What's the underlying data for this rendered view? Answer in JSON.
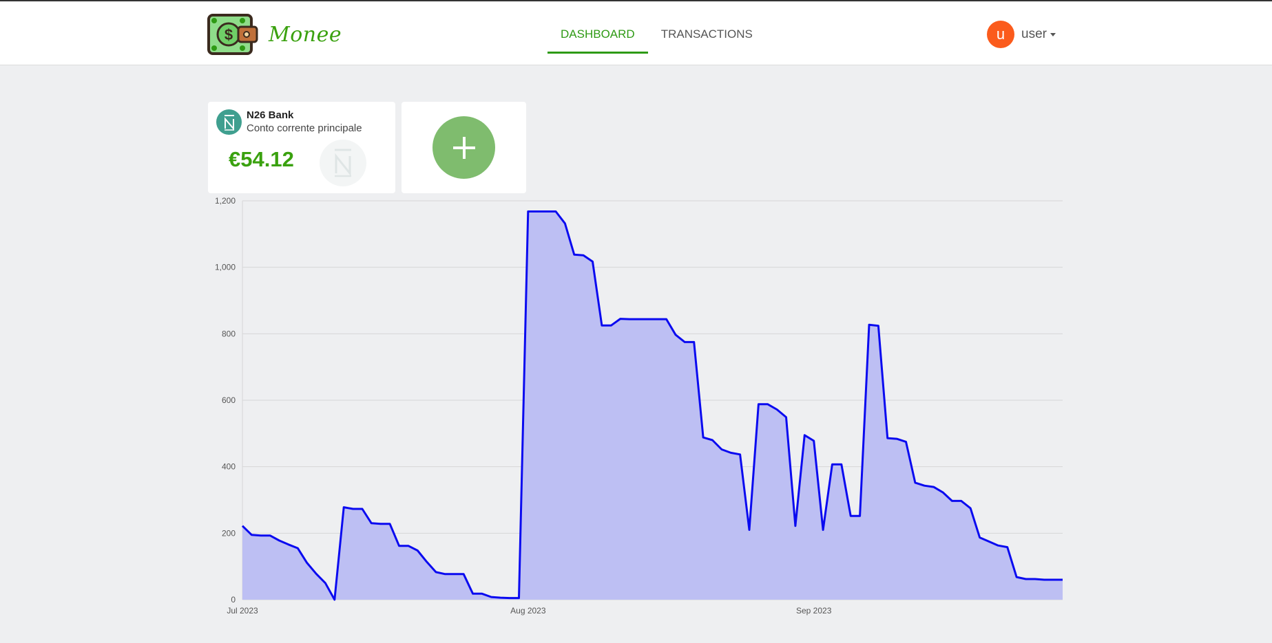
{
  "header": {
    "brand_name": "Monee",
    "logo_icon": "wallet-money-icon",
    "tabs": [
      {
        "label": "DASHBOARD",
        "active": true
      },
      {
        "label": "TRANSACTIONS",
        "active": false
      }
    ],
    "user": {
      "avatar_letter": "u",
      "name": "user"
    }
  },
  "accounts": [
    {
      "bank_name": "N26 Bank",
      "bank_icon": "n26-logo-icon",
      "description": "Conto corrente principale",
      "balance": "€54.12"
    }
  ],
  "add_account": {
    "icon": "plus-icon"
  },
  "colors": {
    "brand": "#3aa10f",
    "active_tab": "#2e9a14",
    "avatar": "#fb5b1c",
    "bank_badge": "#3f9f8f",
    "add_button": "#7fbc6e",
    "series_line": "#0a0af0",
    "series_fill": "#bdbff3"
  },
  "chart_data": {
    "type": "area",
    "x_ticks": [
      "Jul 2023",
      "Aug 2023",
      "Sep 2023"
    ],
    "y_ticks": [
      "0",
      "200",
      "400",
      "600",
      "800",
      "1,000",
      "1,200"
    ],
    "ylim": [
      0,
      1200
    ],
    "xlim": [
      "2023-07-01",
      "2023-09-28"
    ],
    "grid": true,
    "x": [
      "2023-07-01",
      "2023-07-02",
      "2023-07-03",
      "2023-07-04",
      "2023-07-05",
      "2023-07-06",
      "2023-07-07",
      "2023-07-08",
      "2023-07-09",
      "2023-07-10",
      "2023-07-11",
      "2023-07-12",
      "2023-07-13",
      "2023-07-14",
      "2023-07-15",
      "2023-07-16",
      "2023-07-17",
      "2023-07-18",
      "2023-07-19",
      "2023-07-20",
      "2023-07-21",
      "2023-07-22",
      "2023-07-23",
      "2023-07-24",
      "2023-07-25",
      "2023-07-26",
      "2023-07-27",
      "2023-07-28",
      "2023-07-29",
      "2023-07-30",
      "2023-07-31",
      "2023-08-01",
      "2023-08-02",
      "2023-08-03",
      "2023-08-04",
      "2023-08-05",
      "2023-08-06",
      "2023-08-07",
      "2023-08-08",
      "2023-08-09",
      "2023-08-10",
      "2023-08-11",
      "2023-08-12",
      "2023-08-13",
      "2023-08-14",
      "2023-08-15",
      "2023-08-16",
      "2023-08-17",
      "2023-08-18",
      "2023-08-19",
      "2023-08-20",
      "2023-08-21",
      "2023-08-22",
      "2023-08-23",
      "2023-08-24",
      "2023-08-25",
      "2023-08-26",
      "2023-08-27",
      "2023-08-28",
      "2023-08-29",
      "2023-08-30",
      "2023-08-31",
      "2023-09-01",
      "2023-09-02",
      "2023-09-03",
      "2023-09-04",
      "2023-09-05",
      "2023-09-06",
      "2023-09-07",
      "2023-09-08",
      "2023-09-09",
      "2023-09-10",
      "2023-09-11",
      "2023-09-12",
      "2023-09-13",
      "2023-09-14",
      "2023-09-15",
      "2023-09-16",
      "2023-09-17",
      "2023-09-18",
      "2023-09-19",
      "2023-09-20",
      "2023-09-21",
      "2023-09-22",
      "2023-09-23",
      "2023-09-24",
      "2023-09-25",
      "2023-09-26",
      "2023-09-27",
      "2023-09-28"
    ],
    "series": [
      {
        "values": [
          222,
          195,
          193,
          193,
          178,
          166,
          155,
          111,
          78,
          50,
          0,
          278,
          273,
          273,
          230,
          228,
          228,
          162,
          162,
          148,
          114,
          83,
          77,
          77,
          77,
          18,
          18,
          8,
          6,
          5,
          5,
          1168,
          1168,
          1168,
          1168,
          1132,
          1038,
          1036,
          1017,
          825,
          825,
          845,
          844,
          844,
          844,
          844,
          844,
          797,
          775,
          775,
          488,
          480,
          452,
          442,
          437,
          210,
          588,
          588,
          572,
          549,
          222,
          495,
          478,
          210,
          407,
          407,
          252,
          252,
          827,
          824,
          486,
          484,
          475,
          352,
          343,
          339,
          323,
          297,
          297,
          275,
          187,
          175,
          163,
          158,
          68,
          62,
          62,
          60,
          60,
          60
        ]
      }
    ]
  }
}
